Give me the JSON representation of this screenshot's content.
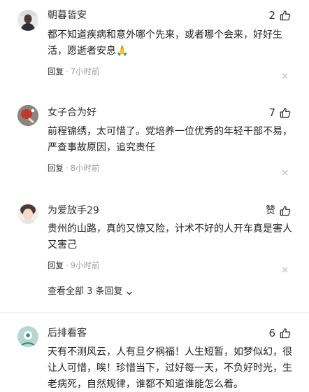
{
  "comments": [
    {
      "username": "朝暮皆安",
      "likes": "2",
      "text": "都不知道疾病和意外哪个先来，或者哪个会来，好好生活，愿逝者安息🙏",
      "reply_label": "回复",
      "time": "7小时前"
    },
    {
      "username": "女子合为好",
      "likes": "7",
      "text": "前程锦绣，太可惜了。党培养一位优秀的年轻干部不易，严查事故原因，追究责任",
      "reply_label": "回复",
      "time": "8小时前"
    },
    {
      "username": "为爱放手29",
      "likes": "赞",
      "text": "贵州的山路，真的又惊又险，计术不好的人开车真是害人又害己",
      "reply_label": "回复",
      "time": "9小时前"
    },
    {
      "username": "后排看客",
      "likes": "6",
      "text": "天有不测风云，人有旦夕祸福！人生短暂，如梦似幻，很让人可惜，唉！珍惜当下，过好每一天，不负好时光，生老病死，自然规律，谁都不知道谁能怎么着。"
    }
  ],
  "view_replies": {
    "label": "查看全部 3 条回复"
  },
  "icons": {
    "like": "thumbs-up-icon",
    "dismiss": "close-icon",
    "expand": "chevron-down-icon"
  },
  "colors": {
    "text_primary": "#222222",
    "text_secondary": "#9a9a9a",
    "background": "#ffffff"
  }
}
